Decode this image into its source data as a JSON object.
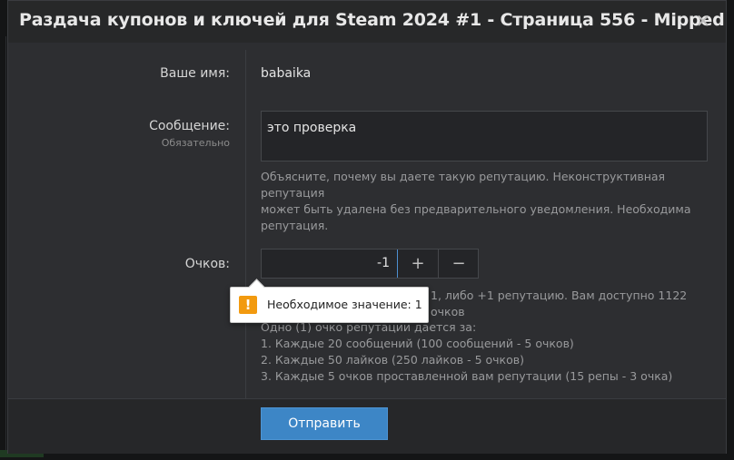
{
  "modal": {
    "title": "Раздача купонов и ключей для Steam 2024 #1 - Страница 556 - Mipped",
    "close_glyph": "✕"
  },
  "form": {
    "name_label": "Ваше имя:",
    "name_value": "babaika",
    "message_label": "Сообщение:",
    "message_required": "Обязательно",
    "message_value": "это проверка",
    "message_hint_line1": "Объясните, почему вы даете такую репутацию. Неконструктивная репутация",
    "message_hint_line2": "может быть удалена без предварительного уведомления. Необходима",
    "message_hint_line3": "репутация.",
    "points_label": "Очков:",
    "points_value": "-1",
    "plus_glyph": "+",
    "minus_glyph": "−",
    "points_hint_line1_tail": "1, либо +1 репутацию. Вам доступно 1122 очков",
    "points_hint_line2": "Одно (1) очко репутации дается за:",
    "points_hint_line3": "1. Каждые 20 сообщений (100 сообщений - 5 очков)",
    "points_hint_line4": "2. Каждые 50 лайков (250 лайков - 5 очков)",
    "points_hint_line5": "3. Каждые 5 очков проставленной вам репутации (15 репы - 3 очка)"
  },
  "tooltip": {
    "icon_glyph": "!",
    "text": "Необходимое значение: 1",
    "color": "#f29a0f"
  },
  "footer": {
    "submit_label": "Отправить"
  }
}
